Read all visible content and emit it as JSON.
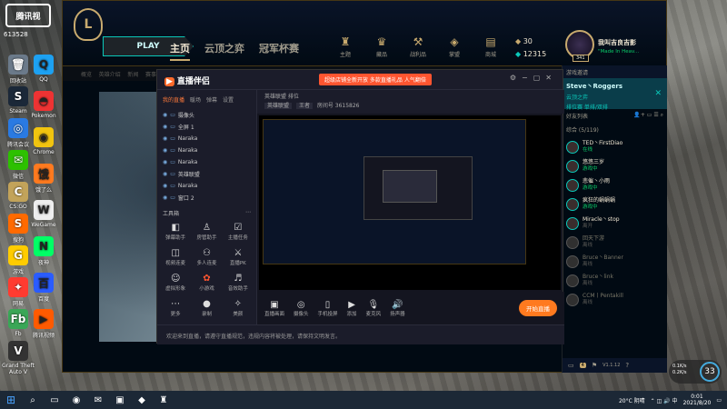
{
  "desktop_icons": [
    {
      "label": "回收站",
      "glyph": "🗑",
      "bg": "#6b7a8a"
    },
    {
      "label": "Steam",
      "glyph": "S",
      "bg": "#1b2838"
    },
    {
      "label": "腾讯会议",
      "glyph": "◎",
      "bg": "#2a7ae2"
    },
    {
      "label": "微信",
      "glyph": "✉",
      "bg": "#2dc100"
    },
    {
      "label": "CS:GO",
      "glyph": "C",
      "bg": "#c2a35a"
    },
    {
      "label": "搜狗",
      "glyph": "S",
      "bg": "#ff6a00"
    },
    {
      "label": "游戏",
      "glyph": "G",
      "bg": "#ffcc00"
    },
    {
      "label": "网易",
      "glyph": "✦",
      "bg": "#ff3b30"
    },
    {
      "label": "Fb",
      "glyph": "Fb",
      "bg": "#3aa757"
    },
    {
      "label": "Grand Theft Auto V",
      "glyph": "V",
      "bg": "#333333"
    }
  ],
  "desktop_icons_col2": [
    {
      "label": "QQ",
      "glyph": "Q",
      "bg": "#1da1f2"
    },
    {
      "label": "Pokemon",
      "glyph": "◓",
      "bg": "#e33"
    },
    {
      "label": "Chrome",
      "glyph": "◉",
      "bg": "#f1c40f"
    },
    {
      "label": "饿了么",
      "glyph": "饿",
      "bg": "#ff7a1f"
    },
    {
      "label": "WeGame",
      "glyph": "W",
      "bg": "#eee"
    },
    {
      "label": "夜神",
      "glyph": "N",
      "bg": "#0f6"
    },
    {
      "label": "百度",
      "glyph": "百",
      "bg": "#2a5cff"
    },
    {
      "label": "腾讯视频",
      "glyph": "▶",
      "bg": "#ff5a00"
    }
  ],
  "top_left": {
    "name": "腾讯视",
    "id": "613528"
  },
  "lol": {
    "play_label": "PLAY",
    "nav": [
      "主页",
      "云顶之弈",
      "冠军杯赛"
    ],
    "top_icons": [
      {
        "label": "主题",
        "glyph": "♜"
      },
      {
        "label": "藏品",
        "glyph": "♛"
      },
      {
        "label": "战利品",
        "glyph": "⚒"
      },
      {
        "label": "掌盟",
        "glyph": "◈"
      },
      {
        "label": "商城",
        "glyph": "▤"
      }
    ],
    "rp": "30",
    "be": "12315",
    "summoner": "我叫吉良吉影",
    "status": "\"Made In Heav...",
    "level": "341",
    "subnav": [
      "概览",
      "英雄介绍",
      "新闻",
      "赛事"
    ]
  },
  "friends": {
    "header": "游戏邀请",
    "invite_name": "Steve丶Roggers",
    "invite_sub": "云顶之弈",
    "invite_sub2": "排位赛 单排/双排",
    "list_title": "好友列表",
    "group": "综合 (5/119)",
    "rows": [
      {
        "name": "TED丶FirstDiao",
        "status": "在线",
        "online": true
      },
      {
        "name": "悠悠三岁",
        "status": "游戏中",
        "online": true
      },
      {
        "name": "悲催丶小雨",
        "status": "游戏中",
        "online": true
      },
      {
        "name": "疯狂的蜗蜗蜗",
        "status": "游戏中",
        "online": true
      },
      {
        "name": "Miracle丶stop",
        "status": "离开",
        "online": true
      },
      {
        "name": "回天下游",
        "status": "离线",
        "online": false
      },
      {
        "name": "Bruce丶Banner",
        "status": "离线",
        "online": false
      },
      {
        "name": "Bruce丶link",
        "status": "离线",
        "online": false
      },
      {
        "name": "CCM丨Pentakill",
        "status": "离线",
        "online": false
      }
    ],
    "bottom_badge": "4",
    "bottom_version": "V1.1.12"
  },
  "stream": {
    "title": "直播伴侣",
    "banner": "超级店铺全新开放 多款直播礼品 人气翻倍",
    "tabs": [
      "我的直播",
      "暖场",
      "弹幕",
      "设置"
    ],
    "layers": [
      {
        "name": "摄像头",
        "on": true
      },
      {
        "name": "全屏 1",
        "on": true
      },
      {
        "name": "Naraka",
        "on": true
      },
      {
        "name": "Naraka",
        "on": true
      },
      {
        "name": "Naraka",
        "on": true
      },
      {
        "name": "英雄联盟",
        "on": true
      },
      {
        "name": "Naraka",
        "on": true
      },
      {
        "name": "窗口 2",
        "on": true
      }
    ],
    "tools_title": "工具箱",
    "tools": [
      {
        "label": "弹幕助手",
        "glyph": "◧",
        "hot": false
      },
      {
        "label": "房管助手",
        "glyph": "♙",
        "hot": false
      },
      {
        "label": "主播任务",
        "glyph": "☑",
        "hot": false
      },
      {
        "label": "视频连麦",
        "glyph": "◫",
        "hot": false
      },
      {
        "label": "多人连麦",
        "glyph": "⚇",
        "hot": false
      },
      {
        "label": "直播PK",
        "glyph": "⚔",
        "hot": false
      },
      {
        "label": "虚拟形象",
        "glyph": "☺",
        "hot": false
      },
      {
        "label": "小游戏",
        "glyph": "✿",
        "hot": true
      },
      {
        "label": "音效助手",
        "glyph": "♬",
        "hot": false
      },
      {
        "label": "更多",
        "glyph": "⋯",
        "hot": false
      },
      {
        "label": "录制",
        "glyph": "●",
        "hot": false
      },
      {
        "label": "美颜",
        "glyph": "✧",
        "hot": false
      }
    ],
    "room_title": "英雄联盟 排位",
    "room_id": "房间号 3615826",
    "room_tags": [
      "英雄联盟",
      "王者"
    ],
    "bottom_buttons": [
      {
        "label": "直播画面",
        "glyph": "▣"
      },
      {
        "label": "摄像头",
        "glyph": "◎"
      },
      {
        "label": "手机投屏",
        "glyph": "▯"
      },
      {
        "label": "添加",
        "glyph": "▶"
      },
      {
        "label": "麦克风",
        "glyph": "🎙"
      },
      {
        "label": "扬声器",
        "glyph": "🔊"
      }
    ],
    "start_label": "开始直播",
    "notice": "欢迎来到直播，请遵守直播规范，违规内容将被处理，请保持文明发言。"
  },
  "taskbar": {
    "apps": [
      "⊞",
      "⌕",
      "▭",
      "◉",
      "✉",
      "▣",
      "◆",
      "♜"
    ],
    "weather": "20°C 阴晴",
    "time": "0:01",
    "date": "2021/8/20"
  },
  "perf": {
    "cpu": "33",
    "net_up": "0.1K/s",
    "net_down": "0.2K/s"
  }
}
